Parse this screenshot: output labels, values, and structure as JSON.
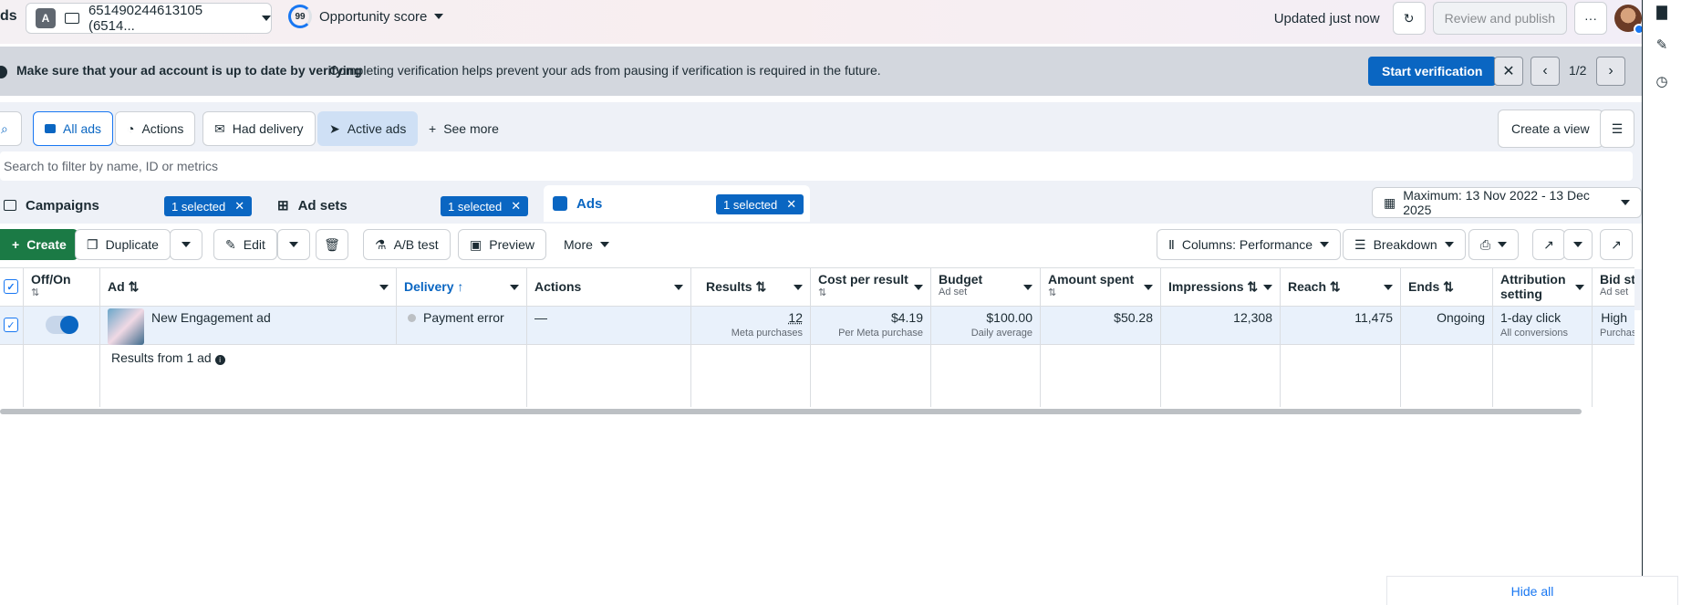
{
  "topbar": {
    "brand": "ds",
    "account_badge": "A",
    "account_label": "651490244613105 (6514...",
    "opportunity_score": "99",
    "opportunity_label": "Opportunity score",
    "updated": "Updated just now",
    "review_publish": "Review and publish",
    "more": "···"
  },
  "banner": {
    "bold": "Make sure that your ad account is up to date by verifying",
    "text": "Completing verification helps prevent your ads from pausing if verification is required in the future.",
    "cta": "Start verification",
    "pager": "1/2"
  },
  "filters": {
    "all_ads": "All ads",
    "actions": "Actions",
    "had_delivery": "Had delivery",
    "active_ads": "Active ads",
    "see_more": "See more",
    "create_view": "Create a view",
    "search_placeholder": "Search to filter by name, ID or metrics"
  },
  "tabs": [
    {
      "label": "Campaigns",
      "selected": "1 selected"
    },
    {
      "label": "Ad sets",
      "selected": "1 selected"
    },
    {
      "label": "Ads",
      "selected": "1 selected"
    }
  ],
  "date_range": "Maximum: 13 Nov 2022 - 13 Dec 2025",
  "toolbar": {
    "create": "Create",
    "duplicate": "Duplicate",
    "edit": "Edit",
    "ab_test": "A/B test",
    "preview": "Preview",
    "more": "More",
    "columns": "Columns: Performance",
    "breakdown": "Breakdown"
  },
  "table": {
    "headers": {
      "offon": "Off/On",
      "ad": "Ad",
      "delivery": "Delivery",
      "actions": "Actions",
      "results": "Results",
      "cost": "Cost per result",
      "budget": "Budget",
      "budget_sub": "Ad set",
      "spent": "Amount spent",
      "impressions": "Impressions",
      "reach": "Reach",
      "ends": "Ends",
      "attribution": "Attribution setting",
      "bid": "Bid stra",
      "bid_sub": "Ad set"
    },
    "row": {
      "ad_name": "New Engagement ad",
      "delivery": "Payment error",
      "actions": "—",
      "results": "12",
      "results_sub": "Meta purchases",
      "cost": "$4.19",
      "cost_sub": "Per Meta purchase",
      "budget": "$100.00",
      "budget_sub": "Daily average",
      "spent": "$50.28",
      "impressions": "12,308",
      "reach": "11,475",
      "ends": "Ongoing",
      "attribution": "1-day click",
      "attribution_sub": "All conversions",
      "bid": "High",
      "bid_sub": "Purchase"
    },
    "footer": "Results from 1 ad"
  },
  "hide_all": "Hide all",
  "colors": {
    "accent": "#0a66c2",
    "create": "#1b7a45",
    "banner": "#d3d7de"
  }
}
